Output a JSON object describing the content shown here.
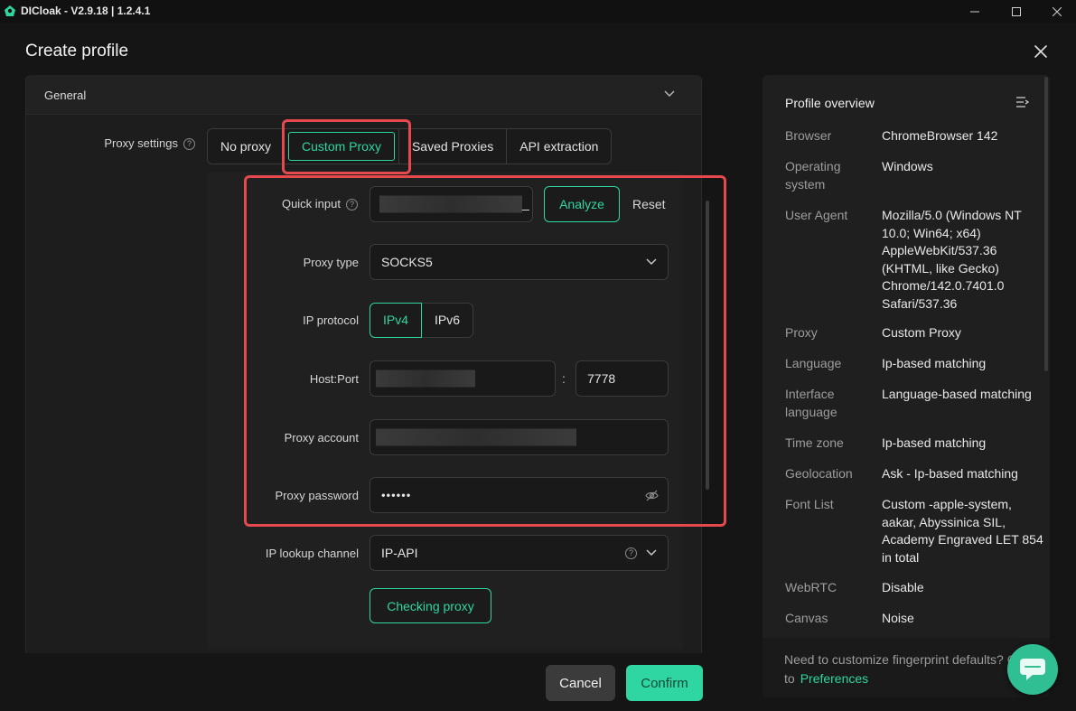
{
  "window": {
    "app_title": "DICloak - V2.9.18 | 1.2.4.1"
  },
  "dialog": {
    "title": "Create profile"
  },
  "general": {
    "label": "General"
  },
  "proxy_settings": {
    "label": "Proxy settings",
    "help": "?",
    "options": [
      "No proxy",
      "Custom Proxy",
      "Saved Proxies",
      "API extraction"
    ],
    "selected": "Custom Proxy"
  },
  "form": {
    "quick_input": {
      "label": "Quick input",
      "help": "?",
      "value_suffix": "_",
      "analyze": "Analyze",
      "reset": "Reset"
    },
    "proxy_type": {
      "label": "Proxy type",
      "value": "SOCKS5"
    },
    "ip_protocol": {
      "label": "IP protocol",
      "options": [
        "IPv4",
        "IPv6"
      ],
      "selected": "IPv4"
    },
    "host_port": {
      "label": "Host:Port",
      "separator": ":",
      "port": "7778"
    },
    "proxy_account": {
      "label": "Proxy account"
    },
    "proxy_password": {
      "label": "Proxy password",
      "value": "••••••"
    },
    "ip_lookup": {
      "label": "IP lookup channel",
      "value": "IP-API",
      "help": "?"
    },
    "checking_proxy": "Checking proxy"
  },
  "footer": {
    "cancel": "Cancel",
    "confirm": "Confirm"
  },
  "overview": {
    "title": "Profile overview",
    "rows": [
      {
        "key": "Browser",
        "value": "ChromeBrowser 142"
      },
      {
        "key": "Operating system",
        "value": "Windows"
      },
      {
        "key": "User Agent",
        "value": "Mozilla/5.0 (Windows NT 10.0; Win64; x64) AppleWebKit/537.36 (KHTML, like Gecko) Chrome/142.0.7401.0 Safari/537.36"
      },
      {
        "key": "Proxy",
        "value": "Custom Proxy"
      },
      {
        "key": "Language",
        "value": "Ip-based matching"
      },
      {
        "key": "Interface language",
        "value": "Language-based matching"
      },
      {
        "key": "Time zone",
        "value": "Ip-based matching"
      },
      {
        "key": "Geolocation",
        "value": "Ask - Ip-based matching"
      },
      {
        "key": "Font List",
        "value": "Custom -apple-system, aakar, Abyssinica SIL, Academy Engraved LET 854 in total"
      },
      {
        "key": "WebRTC",
        "value": "Disable"
      },
      {
        "key": "Canvas",
        "value": "Noise"
      }
    ],
    "footer_text": "Need to customize fingerprint defaults? Go",
    "footer_to": "to",
    "footer_link": "Preferences"
  },
  "colors": {
    "accent": "#2fd6a1",
    "highlight": "#e5484d",
    "background": "#151515"
  },
  "icons": {
    "app_logo": "dicloak-logo-icon",
    "minimize": "minimize-icon",
    "maximize": "maximize-icon",
    "close": "close-icon",
    "overview_menu": "list-collapse-icon",
    "password_toggle": "eye-off-icon",
    "support": "chat-icon"
  }
}
